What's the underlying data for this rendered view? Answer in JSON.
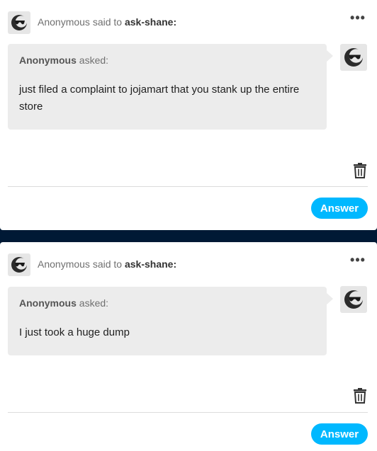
{
  "messages": [
    {
      "sender": "Anonymous",
      "said_to_text": "said to",
      "recipient": "ask-shane:",
      "asker": "Anonymous",
      "asked_text": "asked:",
      "question": "just filed a complaint to jojamart that you stank up the entire store",
      "more_icon": "•••",
      "answer_label": "Answer"
    },
    {
      "sender": "Anonymous",
      "said_to_text": "said to",
      "recipient": "ask-shane:",
      "asker": "Anonymous",
      "asked_text": "asked:",
      "question": "I just took a huge dump",
      "more_icon": "•••",
      "answer_label": "Answer"
    }
  ],
  "icons": {
    "avatar": "sunglasses-avatar-icon",
    "trash": "trash-icon",
    "more": "more-options-icon"
  },
  "colors": {
    "page_background": "#001935",
    "card_background": "#ffffff",
    "bubble_background": "#ececec",
    "answer_button": "#00b8ff"
  }
}
